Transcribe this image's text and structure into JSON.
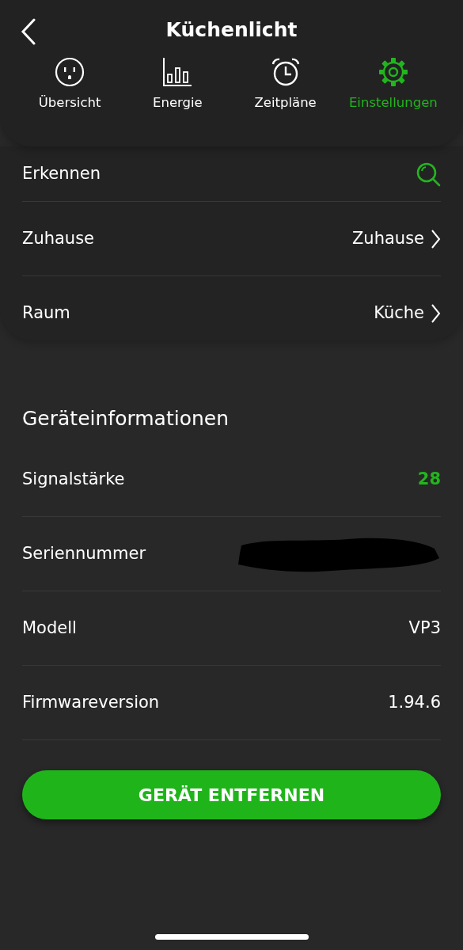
{
  "header": {
    "title": "Küchenlicht"
  },
  "tabs": [
    {
      "label": "Übersicht",
      "selected": false
    },
    {
      "label": "Energie",
      "selected": false
    },
    {
      "label": "Zeitpläne",
      "selected": false
    },
    {
      "label": "Einstellungen",
      "selected": true
    }
  ],
  "settings": [
    {
      "kind": "action",
      "label": "Erkennen"
    },
    {
      "kind": "link",
      "label": "Zuhause",
      "value": "Zuhause"
    },
    {
      "kind": "link",
      "label": "Raum",
      "value": "Küche"
    }
  ],
  "device_info": {
    "heading": "Geräteinformationen",
    "rows": [
      {
        "kind": "highlight",
        "label": "Signalstärke",
        "value": "28"
      },
      {
        "kind": "redacted",
        "label": "Seriennummer"
      },
      {
        "kind": "plain",
        "label": "Modell",
        "value": "VP3"
      },
      {
        "kind": "plain",
        "label": "Firmwareversion",
        "value": "1.94.6"
      }
    ]
  },
  "remove_button": {
    "label": "GERÄT ENTFERNEN"
  }
}
